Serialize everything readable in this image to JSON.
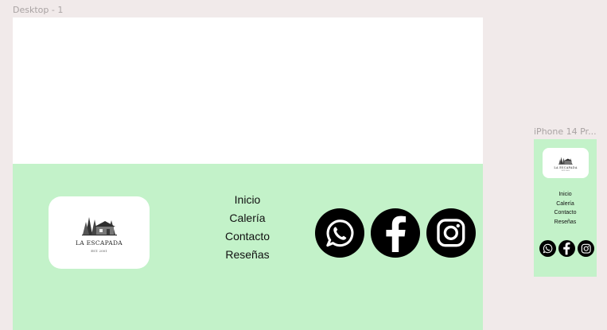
{
  "canvas": {
    "desktop_label": "Desktop - 1",
    "iphone_label": "iPhone 14 Pr..."
  },
  "brand": {
    "name": "LA ESCAPADA",
    "est": "EST. 2001"
  },
  "nav": {
    "items": [
      {
        "label": "Inicio"
      },
      {
        "label": "Calería"
      },
      {
        "label": "Contacto"
      },
      {
        "label": "Reseñas"
      }
    ]
  },
  "social": [
    "whatsapp-icon",
    "facebook-icon",
    "instagram-icon"
  ],
  "colors": {
    "canvas_bg": "#f1eaea",
    "footer_bg": "#c3f2c9",
    "icon_bg": "#000000"
  }
}
